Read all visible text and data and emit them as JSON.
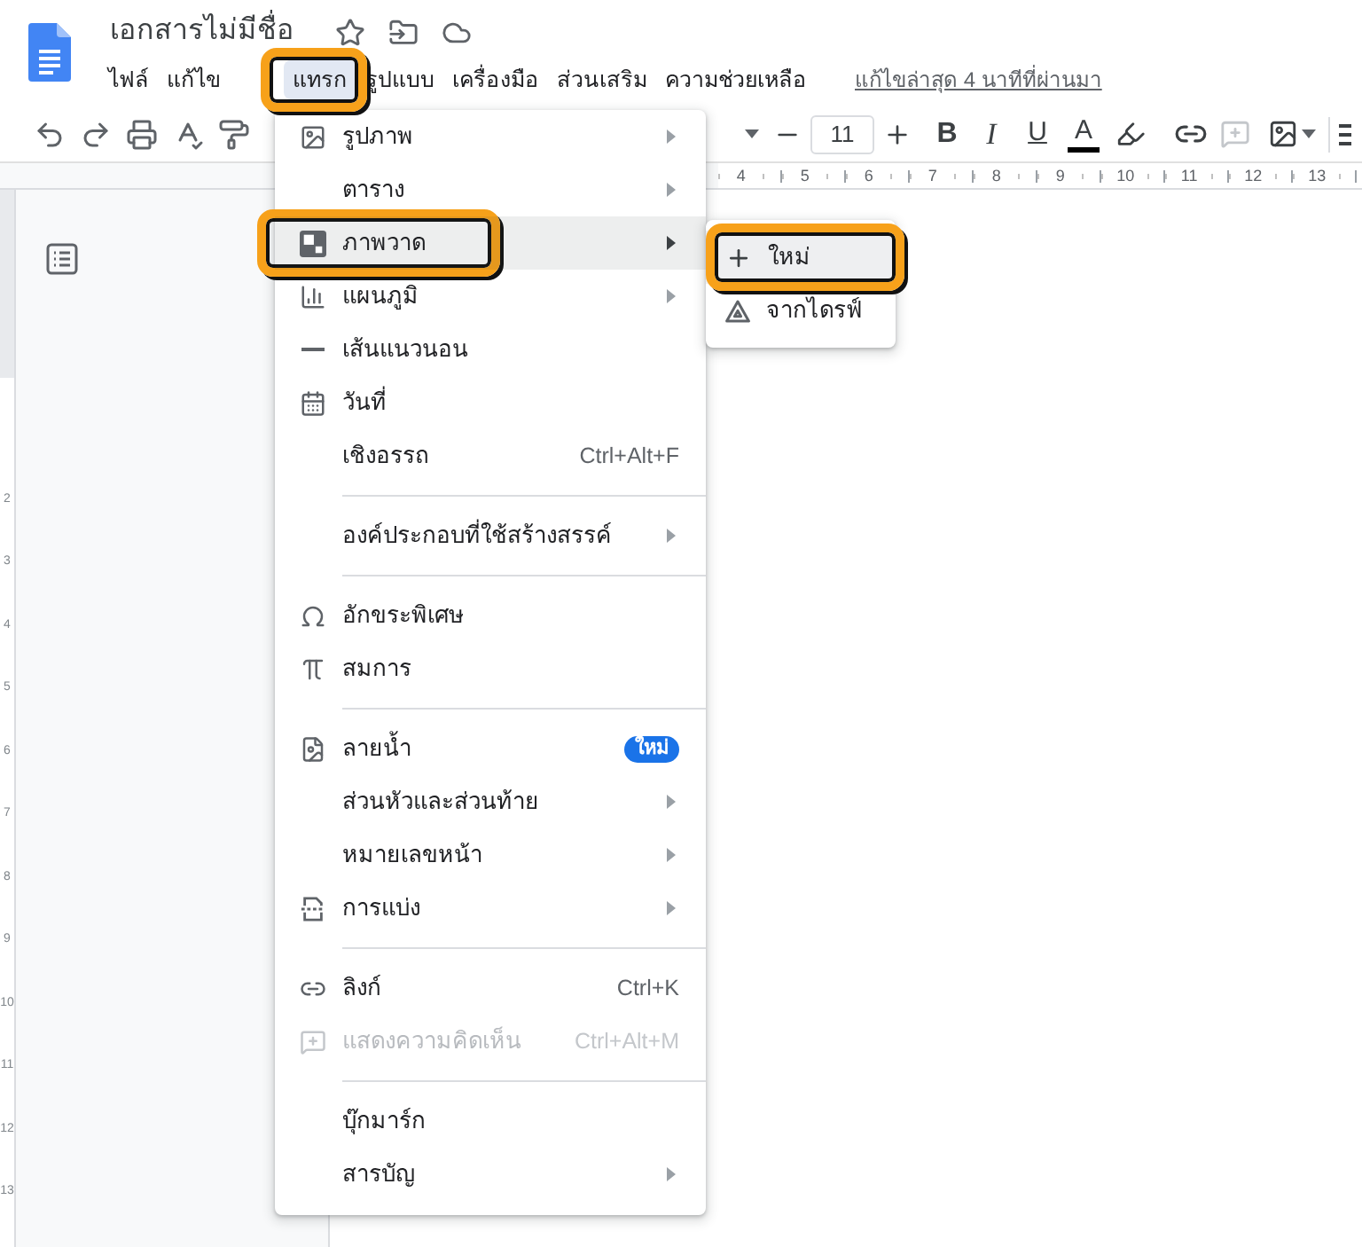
{
  "document": {
    "title": "เอกสารไม่มีชื่อ"
  },
  "menu_bar": {
    "items": [
      {
        "label": "ไฟล์",
        "selected": false,
        "annotated": false
      },
      {
        "label": "แก้ไข",
        "selected": false,
        "annotated": false
      },
      {
        "label": "แทรก",
        "selected": true,
        "annotated": true
      },
      {
        "label": "รูปแบบ",
        "selected": false,
        "annotated": false
      },
      {
        "label": "เครื่องมือ",
        "selected": false,
        "annotated": false
      },
      {
        "label": "ส่วนเสริม",
        "selected": false,
        "annotated": false
      },
      {
        "label": "ความช่วยเหลือ",
        "selected": false,
        "annotated": false
      }
    ],
    "last_edit": "แก้ไขล่าสุด 4 นาทีที่ผ่านมา"
  },
  "toolbar": {
    "font_size": "11",
    "bold": "B",
    "italic": "I",
    "underline": "U",
    "text_color": "A",
    "add_comment": {
      "disabled": true
    }
  },
  "ruler": {
    "labels": [
      "4",
      "5",
      "6",
      "7",
      "8",
      "9",
      "10",
      "11",
      "12",
      "13"
    ]
  },
  "vertical_ruler": {
    "labels": [
      "2",
      "3",
      "4",
      "5",
      "6",
      "7",
      "8",
      "9",
      "10",
      "11",
      "12",
      "13"
    ]
  },
  "insert_menu": {
    "sections": [
      {
        "items": [
          {
            "label": "รูปภาพ",
            "submenu": true,
            "selected": false,
            "annotated": false,
            "disabled": false
          },
          {
            "label": "ตาราง",
            "submenu": true,
            "selected": false,
            "annotated": false,
            "disabled": false
          },
          {
            "label": "ภาพวาด",
            "submenu": true,
            "selected": true,
            "annotated": true,
            "disabled": false
          },
          {
            "label": "แผนภูมิ",
            "submenu": true,
            "selected": false,
            "annotated": false,
            "disabled": false
          },
          {
            "label": "เส้นแนวนอน",
            "submenu": false,
            "selected": false,
            "annotated": false,
            "disabled": false
          },
          {
            "label": "วันที่",
            "submenu": false,
            "selected": false,
            "annotated": false,
            "disabled": false
          },
          {
            "label": "เชิงอรรถ",
            "submenu": false,
            "selected": false,
            "annotated": false,
            "disabled": false,
            "shortcut": "Ctrl+Alt+F"
          }
        ]
      },
      {
        "items": [
          {
            "label": "องค์ประกอบที่ใช้สร้างสรรค์",
            "submenu": true,
            "selected": false,
            "annotated": false,
            "disabled": false
          }
        ]
      },
      {
        "items": [
          {
            "label": "อักขระพิเศษ",
            "submenu": false,
            "selected": false,
            "annotated": false,
            "disabled": false
          },
          {
            "label": "สมการ",
            "submenu": false,
            "selected": false,
            "annotated": false,
            "disabled": false
          }
        ]
      },
      {
        "items": [
          {
            "label": "ลายน้ำ",
            "submenu": false,
            "selected": false,
            "annotated": false,
            "disabled": false,
            "badge": "ใหม่"
          },
          {
            "label": "ส่วนหัวและส่วนท้าย",
            "submenu": true,
            "selected": false,
            "annotated": false,
            "disabled": false
          },
          {
            "label": "หมายเลขหน้า",
            "submenu": true,
            "selected": false,
            "annotated": false,
            "disabled": false
          },
          {
            "label": "การแบ่ง",
            "submenu": true,
            "selected": false,
            "annotated": false,
            "disabled": false
          }
        ]
      },
      {
        "items": [
          {
            "label": "ลิงก์",
            "submenu": false,
            "selected": false,
            "annotated": false,
            "disabled": false,
            "shortcut": "Ctrl+K"
          },
          {
            "label": "แสดงความคิดเห็น",
            "submenu": false,
            "selected": false,
            "annotated": false,
            "disabled": true,
            "shortcut": "Ctrl+Alt+M"
          }
        ]
      },
      {
        "items": [
          {
            "label": "บุ๊กมาร์ก",
            "submenu": false,
            "selected": false,
            "annotated": false,
            "disabled": false
          },
          {
            "label": "สารบัญ",
            "submenu": true,
            "selected": false,
            "annotated": false,
            "disabled": false
          }
        ]
      }
    ]
  },
  "drawing_submenu": {
    "items": [
      {
        "label": "ใหม่",
        "selected": true,
        "annotated": true
      },
      {
        "label": "จากไดรฟ์",
        "selected": false,
        "annotated": false
      }
    ]
  }
}
